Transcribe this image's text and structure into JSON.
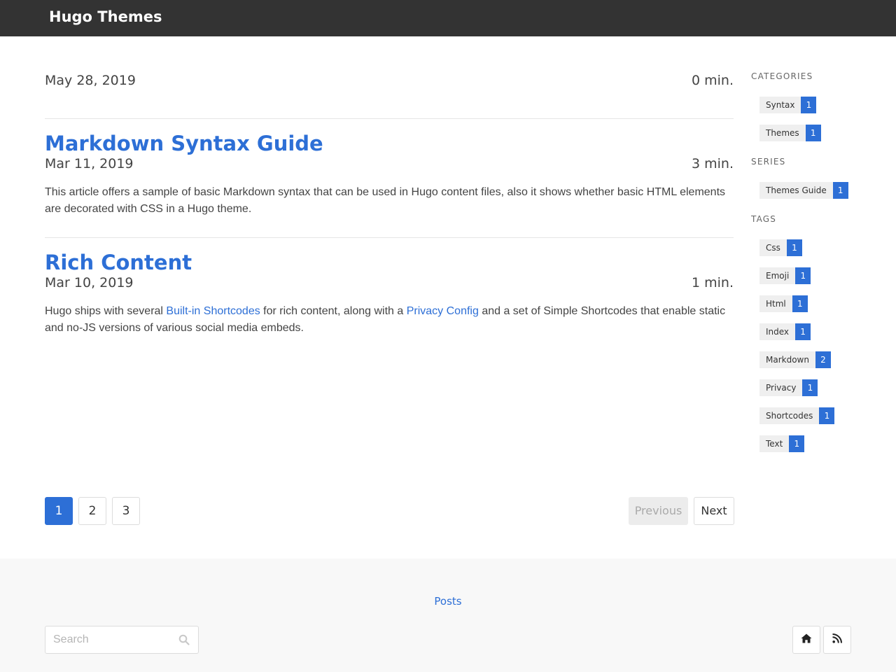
{
  "header": {
    "site_title": "Hugo Themes"
  },
  "posts": [
    {
      "title": "",
      "date": "May 28, 2019",
      "reading_time": "0 min.",
      "summary": ""
    },
    {
      "title": "Markdown Syntax Guide",
      "date": "Mar 11, 2019",
      "reading_time": "3 min.",
      "summary": "This article offers a sample of basic Markdown syntax that can be used in Hugo content files, also it shows whether basic HTML elements are decorated with CSS in a Hugo theme."
    },
    {
      "title": "Rich Content",
      "date": "Mar 10, 2019",
      "reading_time": "1 min.",
      "summary_part1": "Hugo ships with several ",
      "summary_link1": "Built-in Shortcodes",
      "summary_part2": " for rich content, along with a ",
      "summary_link2": "Privacy Config",
      "summary_part3": " and a set of Simple Shortcodes that enable static and no-JS versions of various social media embeds."
    }
  ],
  "sidebar": {
    "categories_heading": "CATEGORIES",
    "categories": [
      {
        "label": "Syntax",
        "count": "1"
      },
      {
        "label": "Themes",
        "count": "1"
      }
    ],
    "series_heading": "SERIES",
    "series": [
      {
        "label": "Themes Guide",
        "count": "1"
      }
    ],
    "tags_heading": "TAGS",
    "tags": [
      {
        "label": "Css",
        "count": "1"
      },
      {
        "label": "Emoji",
        "count": "1"
      },
      {
        "label": "Html",
        "count": "1"
      },
      {
        "label": "Index",
        "count": "1"
      },
      {
        "label": "Markdown",
        "count": "2"
      },
      {
        "label": "Privacy",
        "count": "1"
      },
      {
        "label": "Shortcodes",
        "count": "1"
      },
      {
        "label": "Text",
        "count": "1"
      }
    ]
  },
  "pagination": {
    "pages": [
      "1",
      "2",
      "3"
    ],
    "current": "1",
    "previous_label": "Previous",
    "next_label": "Next"
  },
  "footer": {
    "posts_link": "Posts",
    "search_placeholder": "Search",
    "icons": [
      "home-icon",
      "rss-icon"
    ]
  },
  "colors": {
    "accent": "#2d6fd6",
    "topbar": "#333333",
    "footer_bg": "#f8f8f8"
  }
}
